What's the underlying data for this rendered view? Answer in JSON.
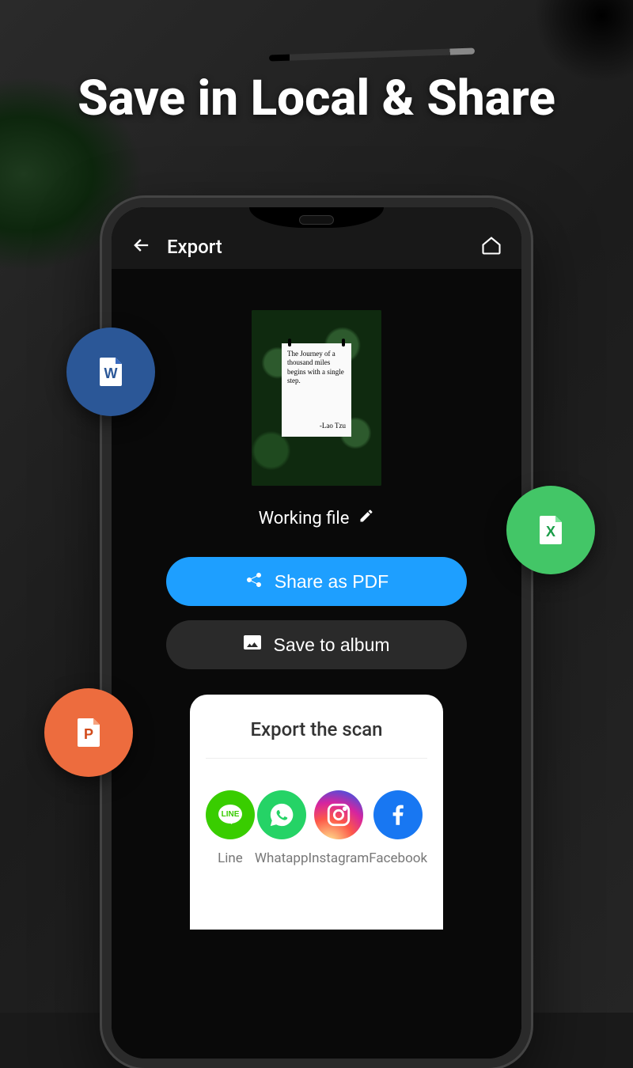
{
  "headline": "Save in Local & Share",
  "header": {
    "title": "Export"
  },
  "preview": {
    "quote_body": "The Journey of a thousand miles begins with a single step.",
    "quote_author": "-Lao Tzu",
    "file_name": "Working file"
  },
  "actions": {
    "share_pdf_label": "Share as PDF",
    "save_album_label": "Save to album"
  },
  "sheet": {
    "title": "Export the scan",
    "options": [
      {
        "label": "Line"
      },
      {
        "label": "Whatapp"
      },
      {
        "label": "Instagram"
      },
      {
        "label": "Facebook"
      }
    ]
  },
  "badges": {
    "word": "word-icon",
    "excel": "excel-icon",
    "powerpoint": "powerpoint-icon"
  },
  "colors": {
    "accent": "#1e9fff",
    "line": "#39cd00",
    "whatsapp": "#25d366",
    "facebook": "#1877f2"
  }
}
